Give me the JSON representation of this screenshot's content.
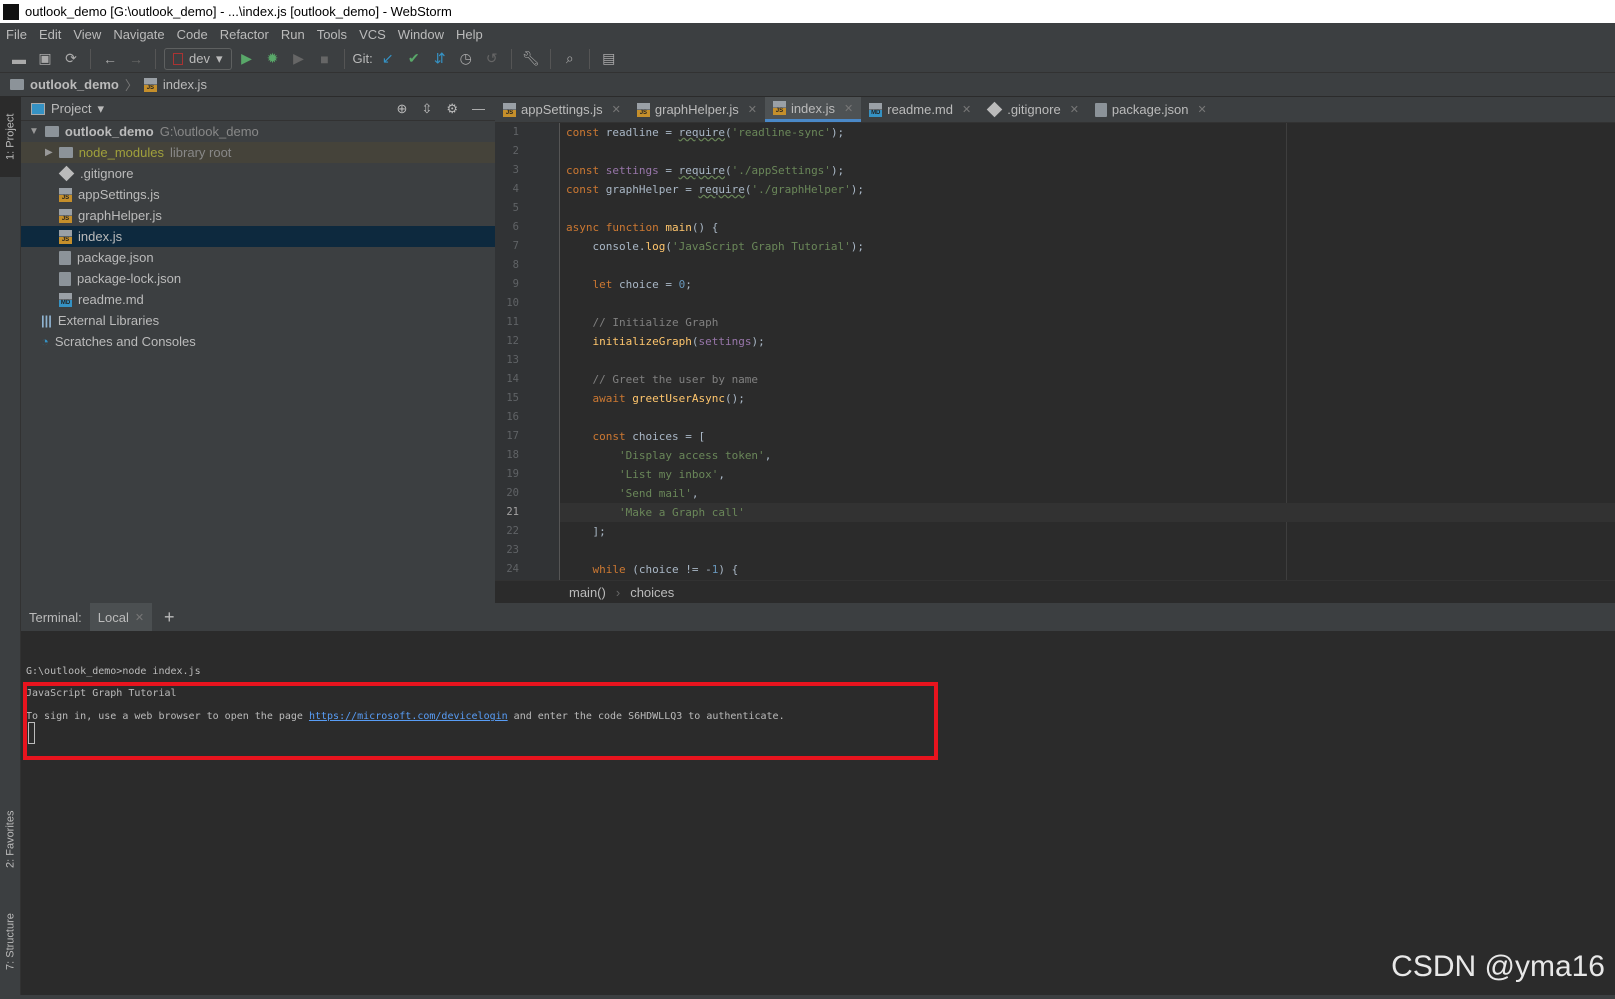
{
  "window": {
    "title": "outlook_demo [G:\\outlook_demo] - ...\\index.js [outlook_demo] - WebStorm",
    "logo": "WS"
  },
  "menu": [
    "File",
    "Edit",
    "View",
    "Navigate",
    "Code",
    "Refactor",
    "Run",
    "Tools",
    "VCS",
    "Window",
    "Help"
  ],
  "toolbar": {
    "run_config": "dev",
    "git_label": "Git:"
  },
  "navbar": {
    "project": "outlook_demo",
    "file": "index.js"
  },
  "sidestripe": {
    "project": "1: Project",
    "favorites": "2: Favorites",
    "structure": "7: Structure"
  },
  "project_panel": {
    "title": "Project",
    "tree": [
      {
        "name": "outlook_demo",
        "extra": "G:\\outlook_demo",
        "icon": "folder",
        "level": 0
      },
      {
        "name": "node_modules",
        "extra": "library root",
        "icon": "folder",
        "level": 1
      },
      {
        "name": ".gitignore",
        "icon": "git",
        "level": 2
      },
      {
        "name": "appSettings.js",
        "icon": "js",
        "level": 2
      },
      {
        "name": "graphHelper.js",
        "icon": "js",
        "level": 2
      },
      {
        "name": "index.js",
        "icon": "js",
        "level": 2,
        "selected": true
      },
      {
        "name": "package.json",
        "icon": "json",
        "level": 2
      },
      {
        "name": "package-lock.json",
        "icon": "json",
        "level": 2
      },
      {
        "name": "readme.md",
        "icon": "md",
        "level": 2
      },
      {
        "name": "External Libraries",
        "icon": "libraries",
        "level": 1
      },
      {
        "name": "Scratches and Consoles",
        "icon": "scratches",
        "level": 1
      }
    ]
  },
  "tabs": [
    {
      "label": "appSettings.js",
      "icon": "js"
    },
    {
      "label": "graphHelper.js",
      "icon": "js"
    },
    {
      "label": "index.js",
      "icon": "js",
      "active": true
    },
    {
      "label": "readme.md",
      "icon": "md"
    },
    {
      "label": ".gitignore",
      "icon": "git"
    },
    {
      "label": "package.json",
      "icon": "json"
    }
  ],
  "editor": {
    "current_line": 21,
    "lines": [
      "const readline = require('readline-sync');",
      "",
      "const settings = require('./appSettings');",
      "const graphHelper = require('./graphHelper');",
      "",
      "async function main() {",
      "    console.log('JavaScript Graph Tutorial');",
      "",
      "    let choice = 0;",
      "",
      "    // Initialize Graph",
      "    initializeGraph(settings);",
      "",
      "    // Greet the user by name",
      "    await greetUserAsync();",
      "",
      "    const choices = [",
      "        'Display access token',",
      "        'List my inbox',",
      "        'Send mail',",
      "        'Make a Graph call'",
      "    ];",
      "",
      "    while (choice != -1) {"
    ]
  },
  "breadcrumbs": [
    "main()",
    "choices"
  ],
  "terminal": {
    "label": "Terminal:",
    "tab": "Local",
    "add": "+",
    "lines": {
      "cmd": "G:\\outlook_demo>node index.js",
      "out1": "JavaScript Graph Tutorial",
      "out2_pre": "To sign in, use a web browser to open the page ",
      "link": "https://microsoft.com/devicelogin",
      "out2_post": " and enter the code S6HDWLLQ3 to authenticate."
    }
  },
  "watermark": "CSDN @yma16",
  "colors": {
    "highlight_box": "#e8141e",
    "accent": "#4a88c7"
  }
}
